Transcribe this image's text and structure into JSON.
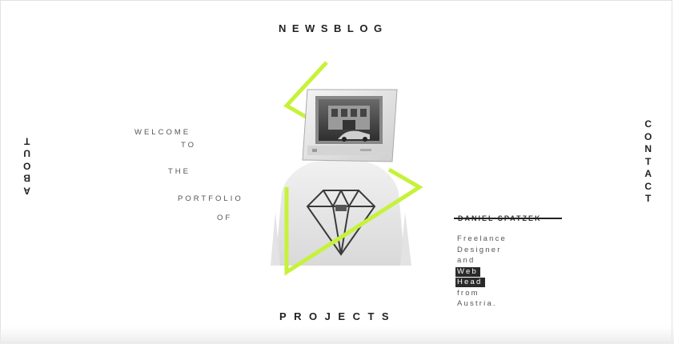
{
  "nav": {
    "top": "NEWSBLOG",
    "bottom": "PROJECTS",
    "left": [
      "A",
      "B",
      "O",
      "U",
      "T"
    ],
    "right": [
      "C",
      "O",
      "N",
      "T",
      "A",
      "C",
      "T"
    ]
  },
  "welcome": {
    "w1": "WELCOME",
    "w2": "TO",
    "w3": "THE",
    "w4": "PORTFOLIO",
    "w5": "OF"
  },
  "profile": {
    "name": "DANIEL SPATZEK",
    "bio": [
      "Freelance",
      "Designer",
      "and",
      "Web",
      "Head",
      "from",
      "Austria."
    ]
  },
  "colors": {
    "accent": "#c6f23a",
    "text": "#222222",
    "highlight_bg": "#2a2a2a"
  }
}
